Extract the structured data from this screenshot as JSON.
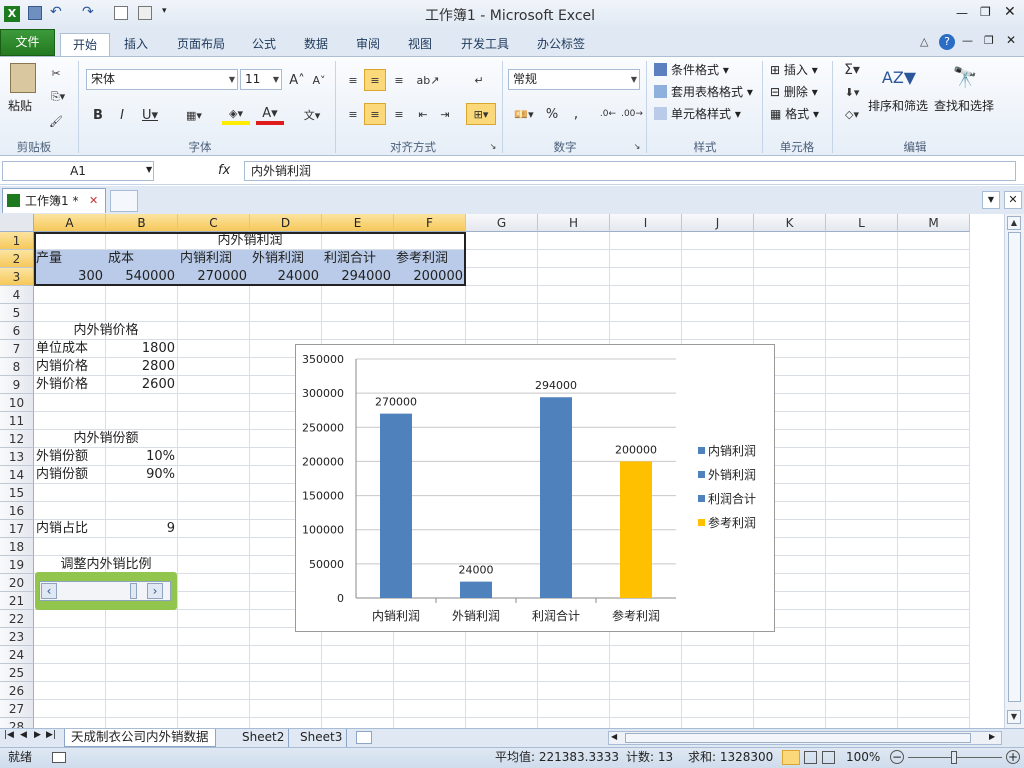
{
  "app": {
    "title": "工作簿1 - Microsoft Excel"
  },
  "ribbon_tabs": [
    "文件",
    "开始",
    "插入",
    "页面布局",
    "公式",
    "数据",
    "审阅",
    "视图",
    "开发工具",
    "办公标签"
  ],
  "ribbon": {
    "clipboard": {
      "paste": "粘贴",
      "label": "剪贴板"
    },
    "font": {
      "name": "宋体",
      "size": "11",
      "label": "字体"
    },
    "alignment": {
      "label": "对齐方式"
    },
    "number": {
      "format": "常规",
      "label": "数字"
    },
    "styles": {
      "conditional": "条件格式",
      "table": "套用表格格式",
      "cell": "单元格样式",
      "label": "样式"
    },
    "cells": {
      "insert": "插入",
      "delete": "删除",
      "format": "格式",
      "label": "单元格"
    },
    "editing": {
      "sort": "排序和筛选",
      "find": "查找和选择",
      "label": "编辑"
    }
  },
  "formula_bar": {
    "name_box": "A1",
    "fx": "fx",
    "formula": "内外销利润"
  },
  "workbook_tab": {
    "label": "工作簿1 *"
  },
  "columns": [
    "A",
    "B",
    "C",
    "D",
    "E",
    "F",
    "G",
    "H",
    "I",
    "J",
    "K",
    "L",
    "M"
  ],
  "rows": [
    "1",
    "2",
    "3",
    "4",
    "5",
    "6",
    "7",
    "8",
    "9",
    "10",
    "11",
    "12",
    "13",
    "14",
    "15",
    "16",
    "17",
    "18",
    "19",
    "20",
    "21",
    "22",
    "23",
    "24",
    "25",
    "26",
    "27",
    "28"
  ],
  "cells": {
    "title": "内外销利润",
    "h_output": "产量",
    "h_cost": "成本",
    "h_dom": "内销利润",
    "h_exp": "外销利润",
    "h_total": "利润合计",
    "h_ref": "参考利润",
    "v_output": "300",
    "v_cost": "540000",
    "v_dom": "270000",
    "v_exp": "24000",
    "v_total": "294000",
    "v_ref": "200000",
    "price_title": "内外销价格",
    "unit_cost_label": "单位成本",
    "unit_cost": "1800",
    "dom_price_label": "内销价格",
    "dom_price": "2800",
    "exp_price_label": "外销价格",
    "exp_price": "2600",
    "share_title": "内外销份额",
    "exp_share_label": "外销份额",
    "exp_share": "10%",
    "dom_share_label": "内销份额",
    "dom_share": "90%",
    "ratio_label": "内销占比",
    "ratio": "9",
    "adjust_label": "调整内外销比例"
  },
  "chart_data": {
    "type": "bar",
    "categories": [
      "内销利润",
      "外销利润",
      "利润合计",
      "参考利润"
    ],
    "values": [
      270000,
      24000,
      294000,
      200000
    ],
    "data_labels": [
      "270000",
      "24000",
      "294000",
      "200000"
    ],
    "colors": [
      "#4f81bd",
      "#4f81bd",
      "#4f81bd",
      "#ffc000"
    ],
    "ylim": [
      0,
      350000
    ],
    "yticks": [
      "0",
      "50000",
      "100000",
      "150000",
      "200000",
      "250000",
      "300000",
      "350000"
    ],
    "legend": [
      {
        "name": "内销利润",
        "color": "#4f81bd"
      },
      {
        "name": "外销利润",
        "color": "#4f81bd"
      },
      {
        "name": "利润合计",
        "color": "#4f81bd"
      },
      {
        "name": "参考利润",
        "color": "#ffc000"
      }
    ],
    "legend_position": "right",
    "grid": true
  },
  "sheet_tabs": [
    "天成制衣公司内外销数据",
    "Sheet2",
    "Sheet3"
  ],
  "status": {
    "ready": "就绪",
    "average": "平均值: 221383.3333",
    "count": "计数: 13",
    "sum": "求和: 1328300",
    "zoom": "100%"
  }
}
